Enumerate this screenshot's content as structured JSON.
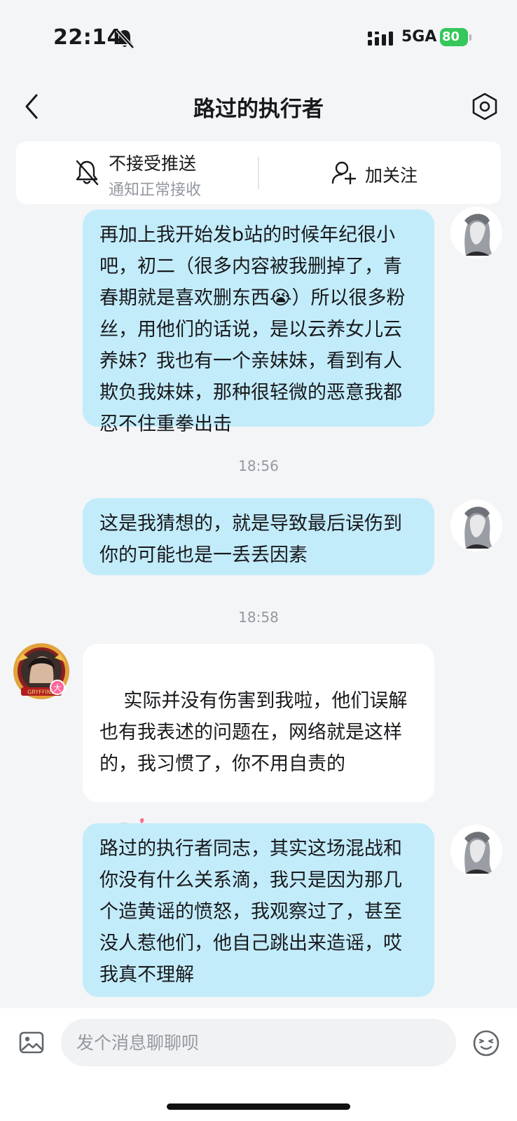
{
  "status_bar": {
    "time": "22:14",
    "network": "5GA",
    "battery": "80"
  },
  "header": {
    "title": "路过的执行者"
  },
  "follow_card": {
    "mute_title": "不接受推送",
    "mute_subtitle": "通知正常接收",
    "follow_label": "加关注"
  },
  "messages": [
    {
      "sender": "me",
      "text": "再加上我开始发b站的时候年纪很小吧，初二（很多内容被我删掉了，青春期就是喜欢删东西😭）所以很多粉丝，用他们的话说，是以云养女儿云养妹？我也有一个亲妹妹，看到有人欺负我妹妹，那种很轻微的恶意我都忍不住重拳出击"
    },
    {
      "type": "time",
      "text": "18:56"
    },
    {
      "sender": "me",
      "text": "这是我猜想的，就是导致最后误伤到你的可能也是一丢丢因素"
    },
    {
      "type": "time",
      "text": "18:58"
    },
    {
      "sender": "them",
      "text": "实际并没有伤害到我啦，他们误解也有我表述的问题在，网络就是这样的，我习惯了，你不用自责的",
      "sticker": "chibi-sticker"
    },
    {
      "sender": "me",
      "text": "路过的执行者同志，其实这场混战和你没有什么关系滴，我只是因为那几个造黄谣的愤怒，我观察过了，甚至没人惹他们，他自己跳出来造谣，哎我真不理解"
    }
  ],
  "other_user": {
    "avatar_badge": "大",
    "avatar_frame_text": "GRYFFIND"
  },
  "input_bar": {
    "placeholder": "发个消息聊聊呗"
  },
  "colors": {
    "my_bubble": "#c3ecfb",
    "their_bubble": "#ffffff",
    "background": "#f4f5f7",
    "battery": "#34c759"
  }
}
